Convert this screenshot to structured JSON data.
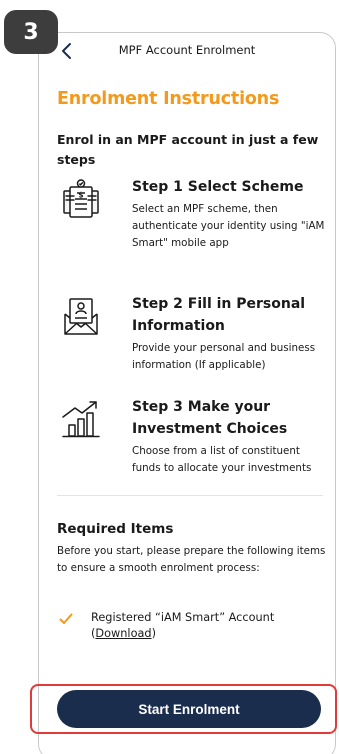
{
  "badge": {
    "number": "3"
  },
  "navbar": {
    "title": "MPF Account Enrolment",
    "back_icon": "chevron-left-icon"
  },
  "page": {
    "heading": "Enrolment Instructions",
    "subheading": "Enrol in an MPF account in just a few steps"
  },
  "steps": [
    {
      "icon": "scheme-document-icon",
      "title": "Step 1 Select Scheme",
      "description": "Select an MPF scheme, then authenticate your identity using \"iAM Smart\" mobile app"
    },
    {
      "icon": "personal-info-envelope-icon",
      "title": "Step 2 Fill in Personal Information",
      "description": "Provide your personal and business information (If applicable)"
    },
    {
      "icon": "investment-chart-icon",
      "title": "Step 3 Make your Investment Choices",
      "description": "Choose from a list of constituent funds to allocate your investments"
    }
  ],
  "required": {
    "title": "Required Items",
    "description": "Before you start, please prepare the following items to ensure a smooth enrolment process:",
    "items": [
      {
        "text_before": "Registered “iAM Smart” Account",
        "link_open": "(",
        "link_text": "Download",
        "link_close": ")"
      }
    ]
  },
  "actions": {
    "start_label": "Start Enrolment"
  },
  "colors": {
    "accent": "#f39a1e",
    "primary_button": "#1b2d4c",
    "highlight": "#e03a3a",
    "badge": "#3d3d3d"
  }
}
